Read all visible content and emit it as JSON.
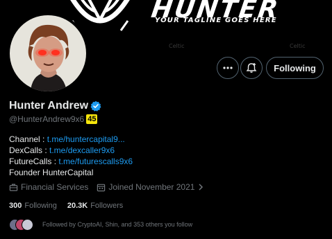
{
  "banner": {
    "wordmark": "HUNTER",
    "tagline": "YOUR TAGLINE GOES HERE",
    "watermark": "Celtic"
  },
  "actions": {
    "more_icon": "more-horizontal-icon",
    "notify_icon": "bell-plus-icon",
    "following_label": "Following"
  },
  "profile": {
    "display_name": "Hunter Andrew",
    "handle": "@HunterAndrew9x6",
    "score": "45",
    "verified_color": "#1d9bf0"
  },
  "bio": {
    "line1_label": "Channel : ",
    "line1_link": "t.me/huntercapital9...",
    "line2_label": "DexCalls : ",
    "line2_link": "t.me/dexcaller9x6",
    "line3_label": "FutureCalls : ",
    "line3_link": "t.me/futurescalls9x6",
    "line4": "Founder HunterCapital"
  },
  "meta": {
    "category": "Financial Services",
    "joined": "Joined November 2021"
  },
  "stats": {
    "following_count": "300",
    "following_label": "Following",
    "followers_count": "20.3K",
    "followers_label": "Followers"
  },
  "followed_by": "Followed by CryptoAI, Shin, and 353 others you follow",
  "colors": {
    "background": "#000000",
    "link": "#1d9bf0",
    "muted": "#71767b",
    "badge": "#f5e50c"
  }
}
